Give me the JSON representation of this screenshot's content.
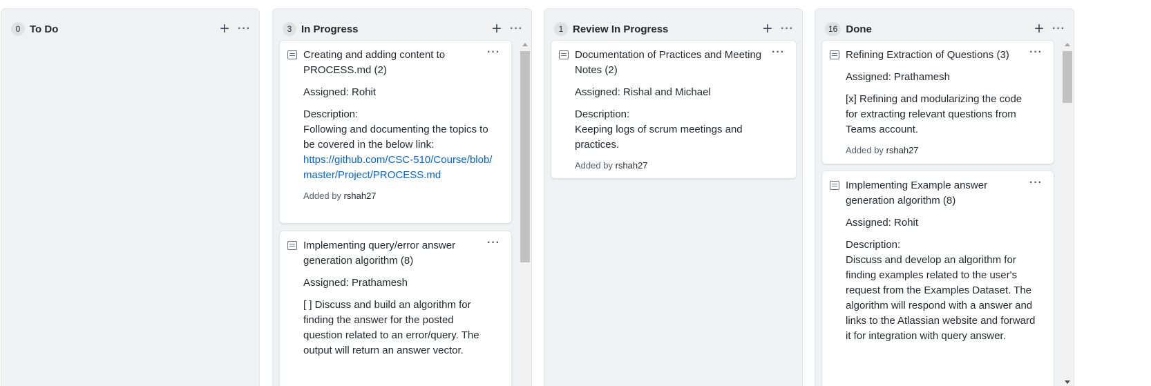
{
  "columns": [
    {
      "count": "0",
      "title": "To Do",
      "cards": []
    },
    {
      "count": "3",
      "title": "In Progress",
      "cards": [
        {
          "title": "Creating and adding content to PROCESS.md (2)",
          "assigned": "Assigned: Rohit",
          "description_label": "Description:",
          "description": "Following and documenting the topics to be covered in the below link:",
          "link": "https://github.com/CSC-510/Course/blob/master/Project/PROCESS.md",
          "added_by_label": "Added by",
          "added_by_user": "rshah27"
        },
        {
          "title": "Implementing query/error answer generation algorithm (8)",
          "assigned": "Assigned: Prathamesh",
          "description": "[ ] Discuss and build an algorithm for finding the answer for the posted question related to an error/query. The output will return an answer vector."
        }
      ]
    },
    {
      "count": "1",
      "title": "Review In Progress",
      "cards": [
        {
          "title": "Documentation of Practices and Meeting Notes (2)",
          "assigned": "Assigned: Rishal and Michael",
          "description_label": "Description:",
          "description": "Keeping logs of scrum meetings and practices.",
          "added_by_label": "Added by",
          "added_by_user": "rshah27"
        }
      ]
    },
    {
      "count": "16",
      "title": "Done",
      "cards": [
        {
          "title": "Refining Extraction of Questions (3)",
          "assigned": "Assigned: Prathamesh",
          "description": "[x] Refining and modularizing the code for extracting relevant questions from Teams account.",
          "added_by_label": "Added by",
          "added_by_user": "rshah27"
        },
        {
          "title": "Implementing Example answer generation algorithm (8)",
          "assigned": "Assigned: Rohit",
          "description_label": "Description:",
          "description": "Discuss and develop an algorithm for finding examples related to the user's request from the Examples Dataset. The algorithm will respond with a answer and links to the Atlassian website and forward it for integration with query answer."
        }
      ]
    }
  ],
  "icons": {
    "add": "+",
    "more": "···",
    "note": "note-icon"
  }
}
